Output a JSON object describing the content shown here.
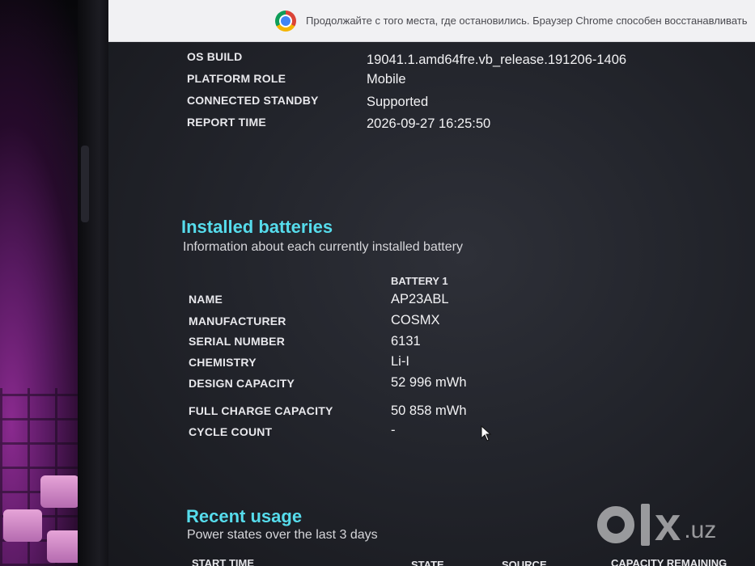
{
  "notification": {
    "text": "Продолжайте с того места, где остановились. Браузер Chrome способен восстанавливать"
  },
  "system_info": [
    {
      "label": "OS BUILD",
      "value": "19041.1.amd64fre.vb_release.191206-1406"
    },
    {
      "label": "PLATFORM ROLE",
      "value": "Mobile"
    },
    {
      "label": "CONNECTED STANDBY",
      "value": "Supported"
    },
    {
      "label": "REPORT TIME",
      "value": "2026-09-27  16:25:50"
    }
  ],
  "installed_batteries": {
    "title": "Installed batteries",
    "subtitle": "Information about each currently installed battery",
    "column_header": "BATTERY 1",
    "rows": [
      {
        "label": "NAME",
        "value": "AP23ABL"
      },
      {
        "label": "MANUFACTURER",
        "value": "COSMX"
      },
      {
        "label": "SERIAL NUMBER",
        "value": "6131"
      },
      {
        "label": "CHEMISTRY",
        "value": "Li-I"
      },
      {
        "label": "DESIGN CAPACITY",
        "value": "52 996 mWh"
      },
      {
        "label": "FULL CHARGE CAPACITY",
        "value": "50 858 mWh"
      },
      {
        "label": "CYCLE COUNT",
        "value": "-"
      }
    ]
  },
  "recent_usage": {
    "title": "Recent usage",
    "subtitle": "Power states over the last 3 days",
    "columns": [
      "START TIME",
      "STATE",
      "SOURCE",
      "CAPACITY REMAINING"
    ]
  },
  "watermark": {
    "brand": "olx",
    "suffix": ".uz"
  },
  "colors": {
    "heading": "#56dcec",
    "screen_bg": "#23252c",
    "notification_bg": "#f1f1f3"
  }
}
